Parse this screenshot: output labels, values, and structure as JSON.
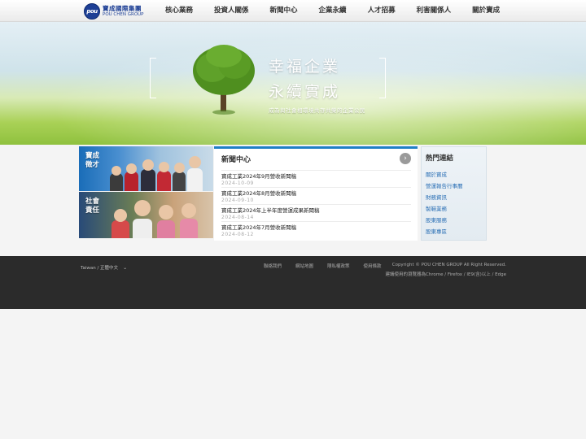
{
  "header": {
    "logo_mark": "pou",
    "logo_cn": "寶成國際集團",
    "logo_en": "POU CHEN GROUP",
    "nav": [
      {
        "label": "核心業務"
      },
      {
        "label": "投資人關係"
      },
      {
        "label": "新聞中心"
      },
      {
        "label": "企業永續"
      },
      {
        "label": "人才招募"
      },
      {
        "label": "利害關係人"
      },
      {
        "label": "關於寶成"
      }
    ]
  },
  "banner": {
    "slogan_line1": "幸福企業",
    "slogan_line2": "永續實成",
    "subtitle": "成為與社會相環境共存共榮的企業公民"
  },
  "photos": {
    "talent_label": "寶成徵才",
    "society_label": "社會責任"
  },
  "news": {
    "title": "新聞中心",
    "more_icon": "›",
    "items": [
      {
        "headline": "寶成工業2024年9月營收新聞稿",
        "date": "2024-10-09"
      },
      {
        "headline": "寶成工業2024年8月營收新聞稿",
        "date": "2024-09-10"
      },
      {
        "headline": "寶成工業2024年上半年度營運成果新聞稿",
        "date": "2024-08-14"
      },
      {
        "headline": "寶成工業2024年7月營收新聞稿",
        "date": "2024-08-12"
      }
    ]
  },
  "hot_links": {
    "title": "熱門連結",
    "items": [
      "關於寶成",
      "營運報告行事曆",
      "財務資訊",
      "製鞋業務",
      "股東服務",
      "股東專區"
    ]
  },
  "footer": {
    "language": "Taiwan / 正體中文",
    "language_caret": "⌄",
    "links": [
      "聯絡我們",
      "網站地圖",
      "隱私權政策",
      "使用條款"
    ],
    "copyright": "Copyright © POU CHEN GROUP All Right Reserved.",
    "browser_note": "建議使用的瀏覽器為Chrome / Firefox / IE9(含)以上 / Edge"
  },
  "colors": {
    "brand_blue": "#1d3f95",
    "accent_blue": "#1f7fc6",
    "link_blue": "#2a6fb5",
    "footer_bg": "#2b2b2b"
  }
}
